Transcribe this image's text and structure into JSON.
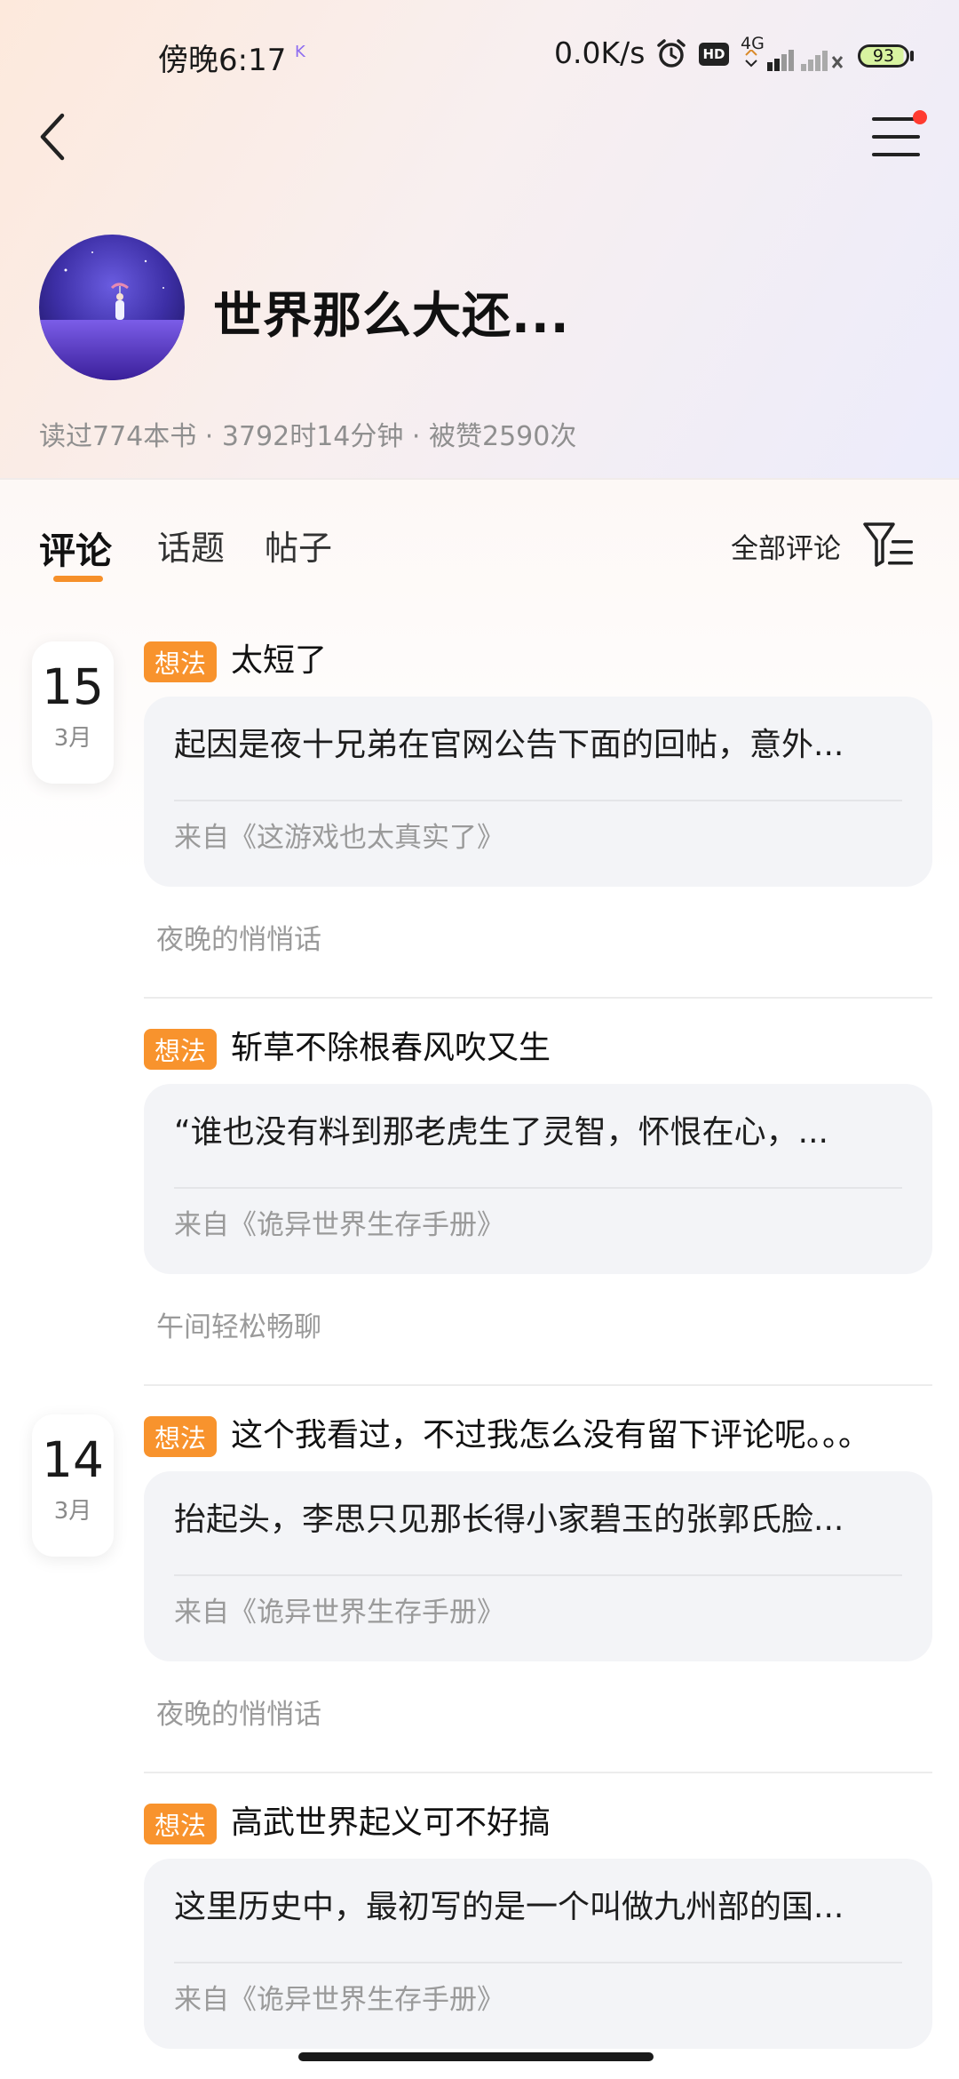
{
  "status_bar": {
    "time": "傍晚6:17",
    "indicator": "K",
    "net_speed": "0.0K/s",
    "hd": "HD",
    "net_type": "4G",
    "battery": "93"
  },
  "profile": {
    "name": "世界那么大还...",
    "stats": "读过774本书 · 3792时14分钟 · 被赞2590次"
  },
  "tabs": [
    {
      "label": "评论",
      "active": true
    },
    {
      "label": "话题",
      "active": false
    },
    {
      "label": "帖子",
      "active": false
    }
  ],
  "filter": {
    "label": "全部评论"
  },
  "dates": [
    {
      "day": "15",
      "month": "3月"
    },
    {
      "day": "14",
      "month": "3月"
    }
  ],
  "posts": [
    {
      "tag": "想法",
      "title": "太短了",
      "excerpt": "起因是夜十兄弟在官网公告下面的回帖，意外...",
      "source": "来自《这游戏也太真实了》",
      "meta": "夜晚的悄悄话"
    },
    {
      "tag": "想法",
      "title": "斩草不除根春风吹又生",
      "excerpt": "“谁也没有料到那老虎生了灵智，怀恨在心，...",
      "source": "来自《诡异世界生存手册》",
      "meta": "午间轻松畅聊"
    },
    {
      "tag": "想法",
      "title": "这个我看过，不过我怎么没有留下评论呢。。。",
      "excerpt": "抬起头，李思只见那长得小家碧玉的张郭氏脸...",
      "source": "来自《诡异世界生存手册》",
      "meta": "夜晚的悄悄话"
    },
    {
      "tag": "想法",
      "title": "高武世界起义可不好搞",
      "excerpt": "这里历史中，最初写的是一个叫做九州部的国...",
      "source": "来自《诡异世界生存手册》",
      "meta": ""
    }
  ],
  "colors": {
    "accent": "#f8932d",
    "notification_dot": "#ff3b30",
    "card_bg": "#f3f4f7"
  },
  "icons": [
    "back-icon",
    "menu-icon",
    "filter-icon",
    "alarm-icon",
    "signal-icon",
    "battery-icon"
  ]
}
